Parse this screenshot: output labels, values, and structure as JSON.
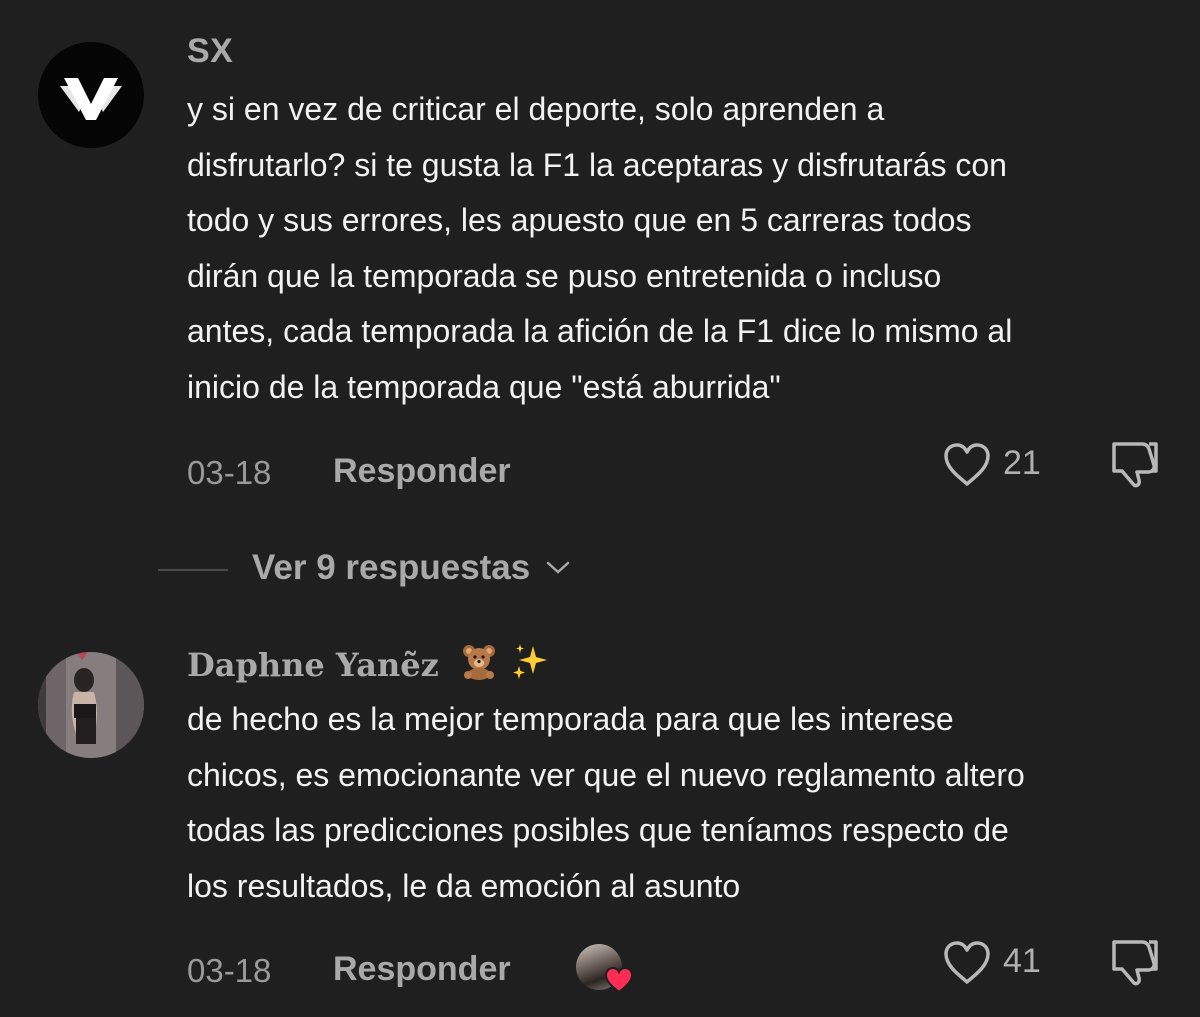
{
  "comments": [
    {
      "username": "SX",
      "text_lines": [
        "y si en vez de criticar el deporte, solo aprenden a",
        "disfrutarlo? si te gusta la F1 la aceptaras y disfrutarás con",
        "todo y sus errores, les apuesto que en 5 carreras todos",
        "dirán que la temporada se puso entretenida o incluso",
        "antes, cada temporada la afición de la F1 dice lo mismo al",
        "inicio de la temporada que \"está aburrida\""
      ],
      "date": "03-18",
      "reply_label": "Responder",
      "like_count": "21",
      "avatar_icon": "winged-v-logo-icon"
    },
    {
      "username": "Daphne Yanẽz",
      "username_emojis": [
        "teddy-bear-icon",
        "sparkles-icon"
      ],
      "text_lines": [
        "de hecho es la mejor temporada para que les interese",
        "chicos, es emocionante ver que el nuevo reglamento altero",
        "todas las predicciones posibles que teníamos respecto de",
        "los resultados, le da emoción al asunto"
      ],
      "date": "03-18",
      "reply_label": "Responder",
      "like_count": "41",
      "creator_liked": true
    }
  ],
  "view_replies": {
    "label": "Ver 9 respuestas"
  },
  "colors": {
    "background": "#1f1f1f",
    "primary_text": "#f2f2f2",
    "secondary_text": "#a9a9a9",
    "heart_badge": "#ff2d55"
  }
}
